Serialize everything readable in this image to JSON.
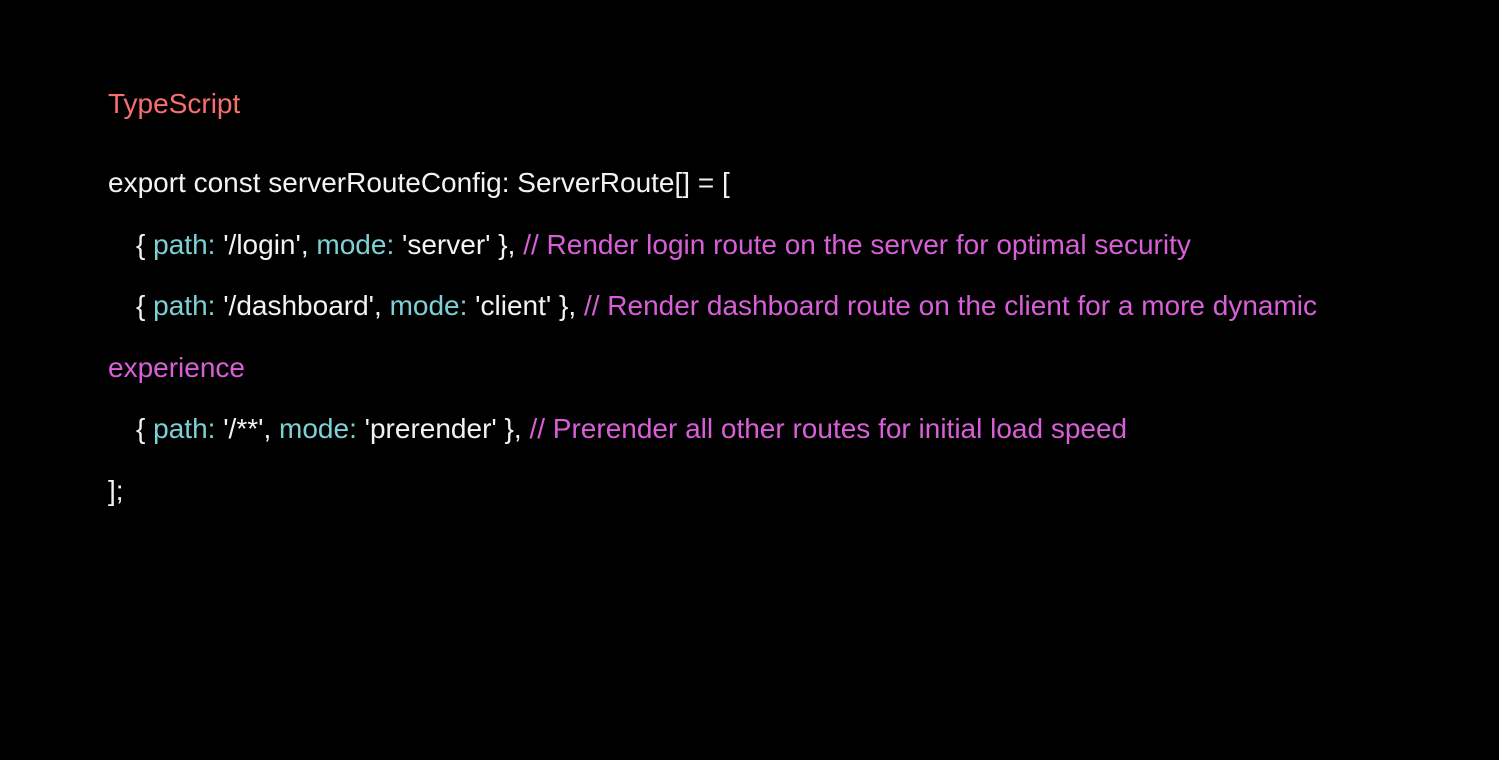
{
  "language_label": "TypeScript",
  "code": {
    "decl_open": "export const serverRouteConfig: ServerRoute[] = [",
    "rows": [
      {
        "path_key": "path:",
        "path_val": " '/login'",
        "sep1": ", ",
        "mode_key": "mode:",
        "mode_val": " 'server'",
        "close": " },  ",
        "comment_prefix": "// ",
        "comment": "Render login route on the server for optimal security"
      },
      {
        "path_key": "path:",
        "path_val": " '/dashboard'",
        "sep1": ", ",
        "mode_key": "mode:",
        "mode_val": " 'client'",
        "close": " }, ",
        "comment_prefix": "// ",
        "comment": "Render dashboard route on the client for a more dynamic experience"
      },
      {
        "path_key": "path:",
        "path_val": " '/**'",
        "sep1": ", ",
        "mode_key": "mode:",
        "mode_val": " 'prerender'",
        "close": " }, ",
        "comment_prefix": "// ",
        "comment": "Prerender all other routes for initial load speed"
      }
    ],
    "decl_close": "];"
  }
}
